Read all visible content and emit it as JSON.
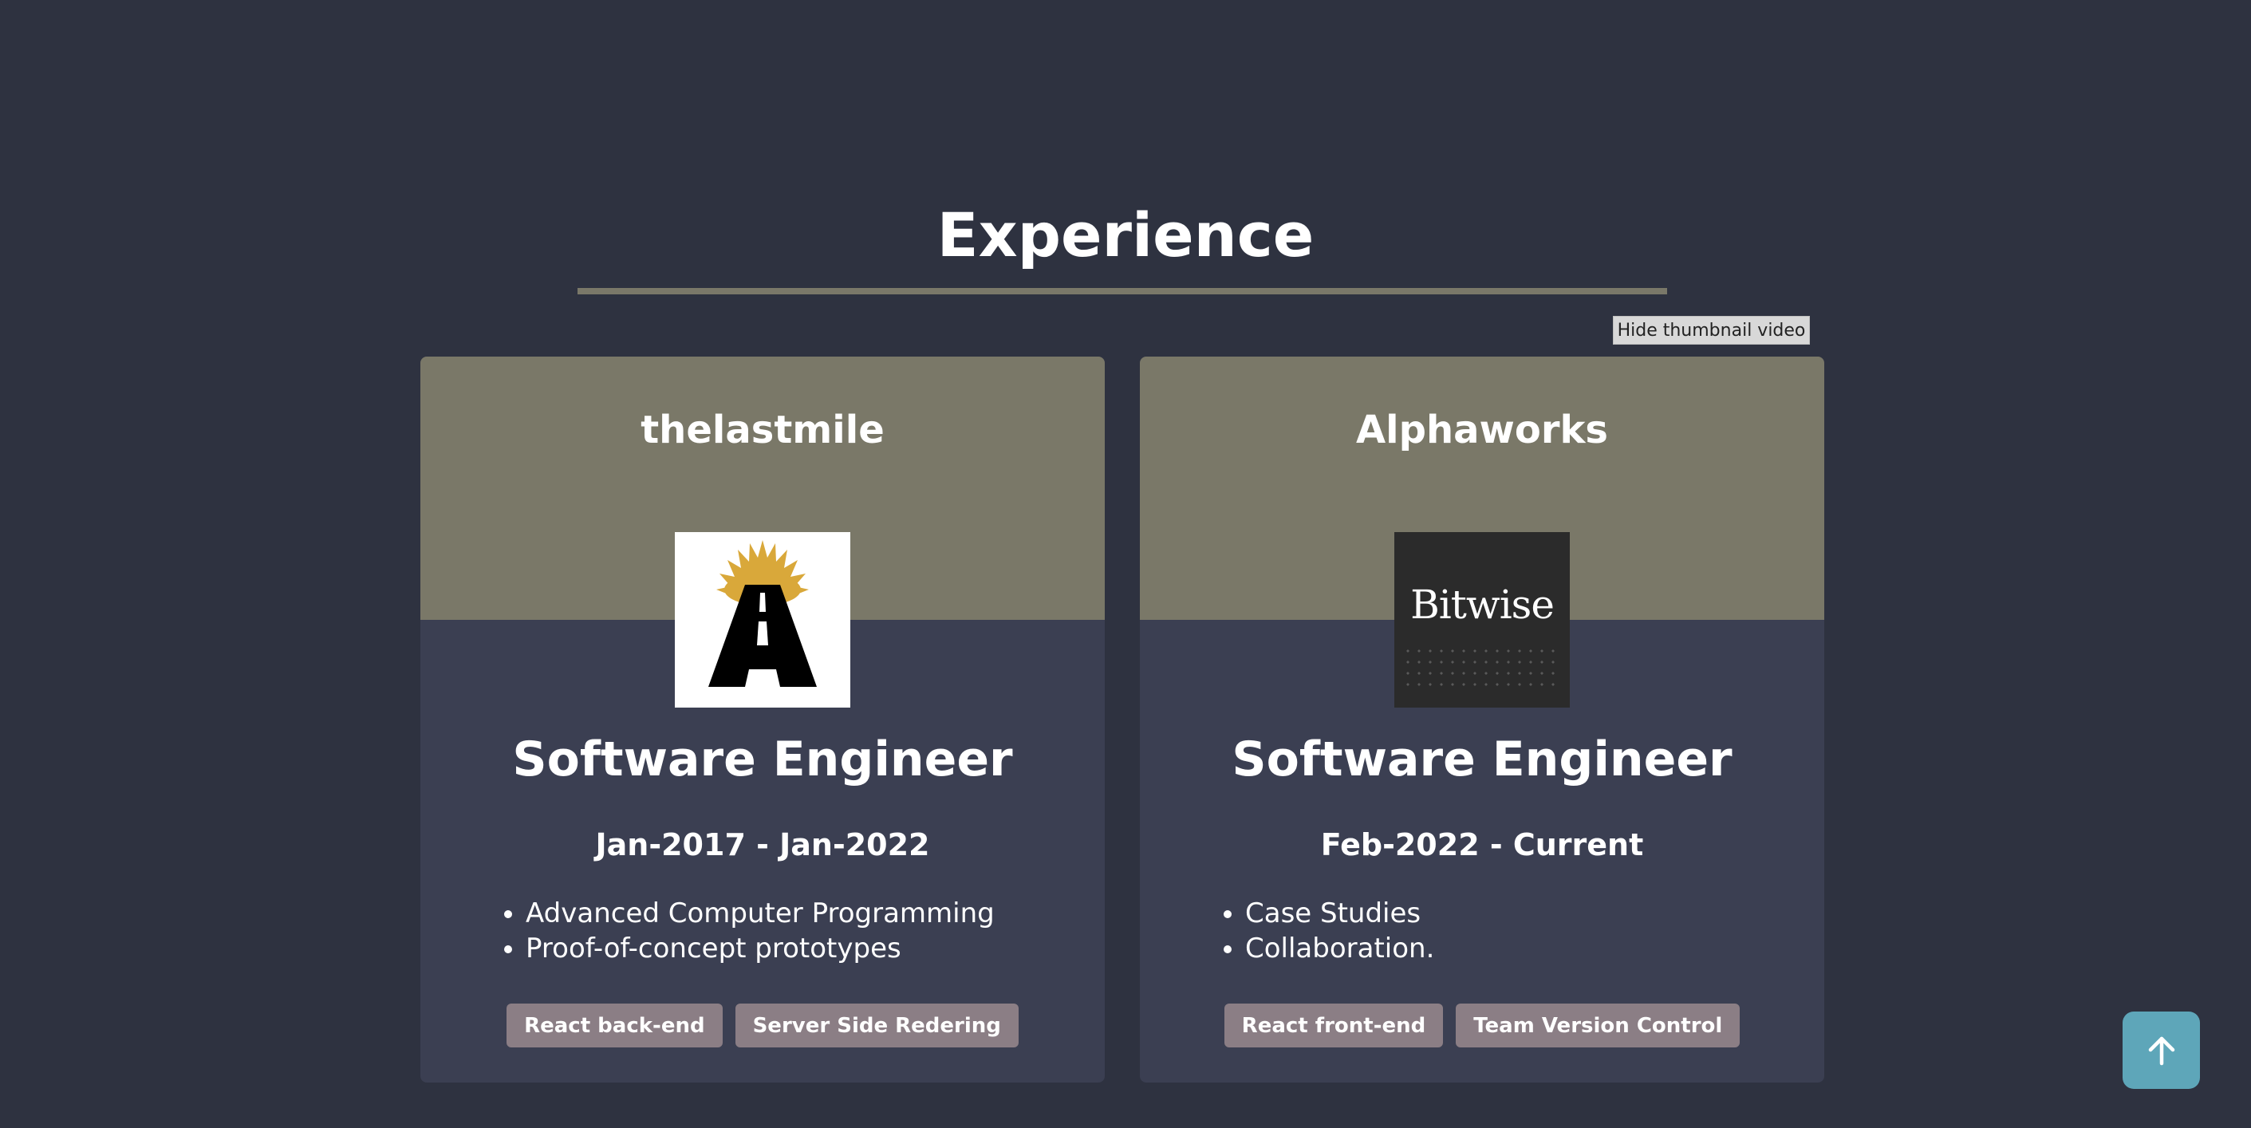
{
  "section": {
    "title": "Experience"
  },
  "controls": {
    "hide_video_label": "Hide thumbnail video",
    "scroll_top_icon": "arrow-up-icon"
  },
  "experience": [
    {
      "company": "thelastmile",
      "logo_icon": "thelastmile-logo",
      "role": "Software Engineer",
      "dates": "Jan-2017 - Jan-2022",
      "bullets": [
        "Advanced Computer Programming",
        "Proof-of-concept prototypes"
      ],
      "tags": [
        "React back-end",
        "Server Side Redering"
      ]
    },
    {
      "company": "Alphaworks",
      "logo_icon": "bitwise-logo",
      "logo_text": "Bitwise",
      "role": "Software Engineer",
      "dates": "Feb-2022 - Current",
      "bullets": [
        "Case Studies",
        "Collaboration."
      ],
      "tags": [
        "React front-end",
        "Team Version Control"
      ]
    }
  ],
  "colors": {
    "background": "#2e3240",
    "card": "#3b3f52",
    "card_header": "#7a7868",
    "tag": "#8b7e85",
    "scroll_button": "#5ea6b9",
    "logo_sun": "#d9a83a"
  }
}
